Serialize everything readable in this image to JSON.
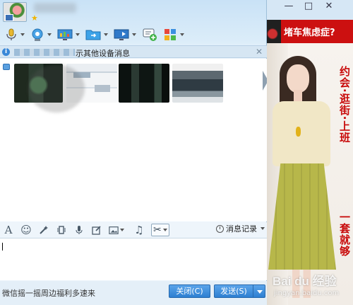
{
  "window": {
    "minimize_glyph": "—",
    "maximize_glyph": "□",
    "close_glyph": "✕",
    "favorite_glyph": "★"
  },
  "toolbar": {
    "items": [
      {
        "icon": "microphone-icon"
      },
      {
        "icon": "webcam-icon"
      },
      {
        "icon": "screen-share-icon"
      },
      {
        "icon": "file-transfer-icon"
      },
      {
        "icon": "remote-desktop-icon"
      },
      {
        "icon": "chat-add-icon"
      },
      {
        "icon": "apps-grid-icon"
      }
    ]
  },
  "notice": {
    "info_glyph": "i",
    "text": "示其他设备消息",
    "close_glyph": "✕"
  },
  "format_bar": {
    "font_glyph": "A",
    "emoji_glyph": "☺",
    "music_glyph": "♫",
    "scissors_glyph": "✂",
    "history_label": "消息记录"
  },
  "bottom": {
    "promo_text": "微信摇一摇周边福利多速来",
    "close_button": "关闭(C)",
    "send_button": "发送(S)"
  },
  "ad": {
    "banner_text": "堵车焦虑症?",
    "slogan_top": "约会·逛街·上班",
    "slogan_bottom": "一套就够"
  },
  "watermark": {
    "logo": "Bai du 经验",
    "url": "jingyan.baidu.com"
  },
  "colors": {
    "accent": "#2d7fd1",
    "ad_red": "#cc1010",
    "slogan_red": "#c80a0a"
  }
}
